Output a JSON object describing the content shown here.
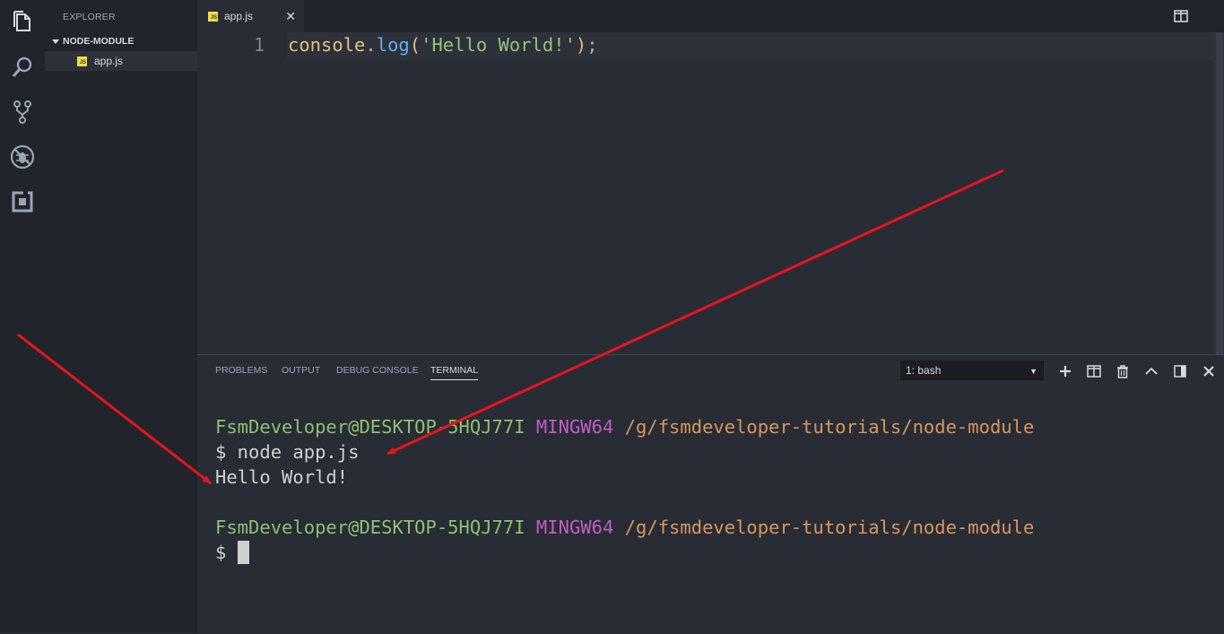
{
  "activity_bar": {
    "icons": [
      "files-icon",
      "search-icon",
      "source-control-icon",
      "debug-icon",
      "extensions-icon"
    ]
  },
  "sidebar": {
    "title": "EXPLORER",
    "folder": "NODE-MODULE",
    "files": [
      {
        "name": "app.js",
        "icon_label": "JS"
      }
    ]
  },
  "tabs": [
    {
      "label": "app.js",
      "icon_label": "JS",
      "active": true
    }
  ],
  "editor": {
    "line_number": "1",
    "code": {
      "object": "console",
      "dot": ".",
      "method": "log",
      "open_paren": "(",
      "string": "'Hello World!'",
      "close_paren": ")",
      "semicolon": ";"
    }
  },
  "panel": {
    "tabs": [
      "PROBLEMS",
      "OUTPUT",
      "DEBUG CONSOLE",
      "TERMINAL"
    ],
    "active_tab": "TERMINAL",
    "terminal_select": "1: bash"
  },
  "terminal": {
    "user_host": "FsmDeveloper@DESKTOP-5HQJ77I",
    "mingw": "MINGW64",
    "path": "/g/fsmdeveloper-tutorials/node-module",
    "command": "$ node app.js",
    "output": "Hello World!",
    "prompt": "$ "
  },
  "colors": {
    "annotation_arrow": "#e8141b",
    "user_host": "#8fc06f",
    "mingw": "#c45bc8",
    "path": "#d8975c"
  }
}
